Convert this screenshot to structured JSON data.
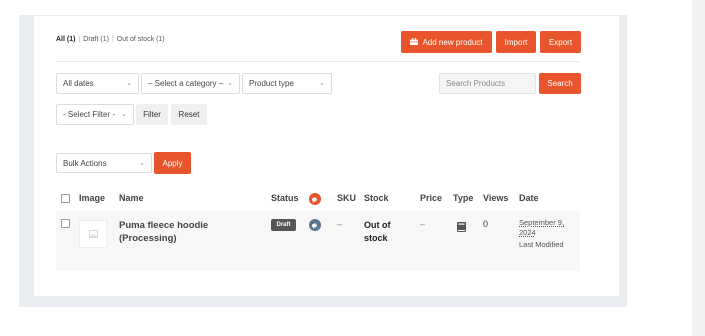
{
  "tabs": [
    {
      "label": "All (1)",
      "active": true
    },
    {
      "label": "Draft (1)",
      "active": false
    },
    {
      "label": "Out of stock (1)",
      "active": false
    }
  ],
  "toolbar": {
    "add_new_label": "Add new product",
    "import_label": "Import",
    "export_label": "Export"
  },
  "filters": {
    "dates_value": "All dates",
    "category_value": "– Select a category –",
    "type_value": "Product type",
    "search_placeholder": "Search Products",
    "search_button": "Search",
    "filter_select_value": "- Select Filter -",
    "filter_button": "Filter",
    "reset_button": "Reset"
  },
  "bulk": {
    "actions_value": "Bulk Actions",
    "apply_label": "Apply"
  },
  "table": {
    "headers": {
      "image": "Image",
      "name": "Name",
      "status": "Status",
      "sku": "SKU",
      "stock": "Stock",
      "price": "Price",
      "type": "Type",
      "views": "Views",
      "date": "Date"
    },
    "rows": [
      {
        "name": "Puma fleece hoodie (Processing)",
        "status": "Draft",
        "sku": "–",
        "stock": "Out of stock",
        "price": "–",
        "views": "0",
        "date": "September 9, 2024",
        "date_note": "Last Modified"
      }
    ]
  },
  "colors": {
    "accent": "#e8542b",
    "draft_badge": "#555555",
    "featured_icon": "#5b7490"
  },
  "icons": {
    "add": "briefcase-icon",
    "featured_header": "megaphone-icon",
    "featured_row": "megaphone-icon",
    "type": "book-icon",
    "thumbnail": "image-placeholder-icon"
  }
}
